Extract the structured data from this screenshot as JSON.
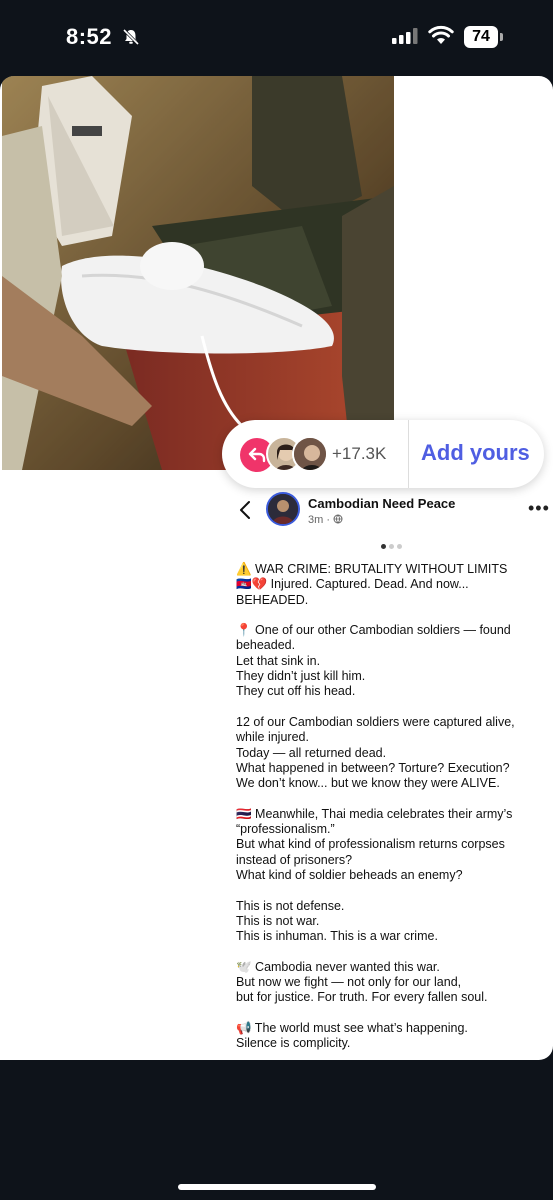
{
  "status_bar": {
    "time": "8:52",
    "battery": "74"
  },
  "story": {
    "reply_count": "+17.3K",
    "add_yours_label": "Add yours"
  },
  "post": {
    "page_name": "Cambodian Need Peace",
    "time": "3m · ",
    "paragraphs": [
      [
        "⚠️ WAR CRIME: BRUTALITY WITHOUT LIMITS",
        "🇰🇭💔 Injured. Captured. Dead. And now...",
        "BEHEADED."
      ],
      [
        "📍 One of our other Cambodian soldiers — found",
        "beheaded.",
        "Let that sink in.",
        "They didn’t just kill him.",
        "They cut off his head."
      ],
      [
        "12 of our Cambodian soldiers were captured alive,",
        "while injured.",
        "Today — all returned dead.",
        "What happened in between? Torture? Execution?",
        "We don’t know... but we know they were ALIVE."
      ],
      [
        "🇹🇭 Meanwhile, Thai media celebrates their army’s",
        "“professionalism.”",
        "But what kind of professionalism returns corpses",
        "instead of prisoners?",
        "What kind of soldier beheads an enemy?"
      ],
      [
        "This is not defense.",
        "This is not war.",
        "This is inhuman. This is a war crime."
      ],
      [
        "🕊️ Cambodia never wanted this war.",
        "But now we fight — not only for our land,",
        "but for justice. For truth. For every fallen soul."
      ],
      [
        "📢 The world must see what’s happening.",
        "Silence is complicity."
      ]
    ]
  },
  "colors": {
    "background": "#0e131a",
    "accent_pink": "#f0346a",
    "add_yours_blue": "#4f5ee2"
  }
}
